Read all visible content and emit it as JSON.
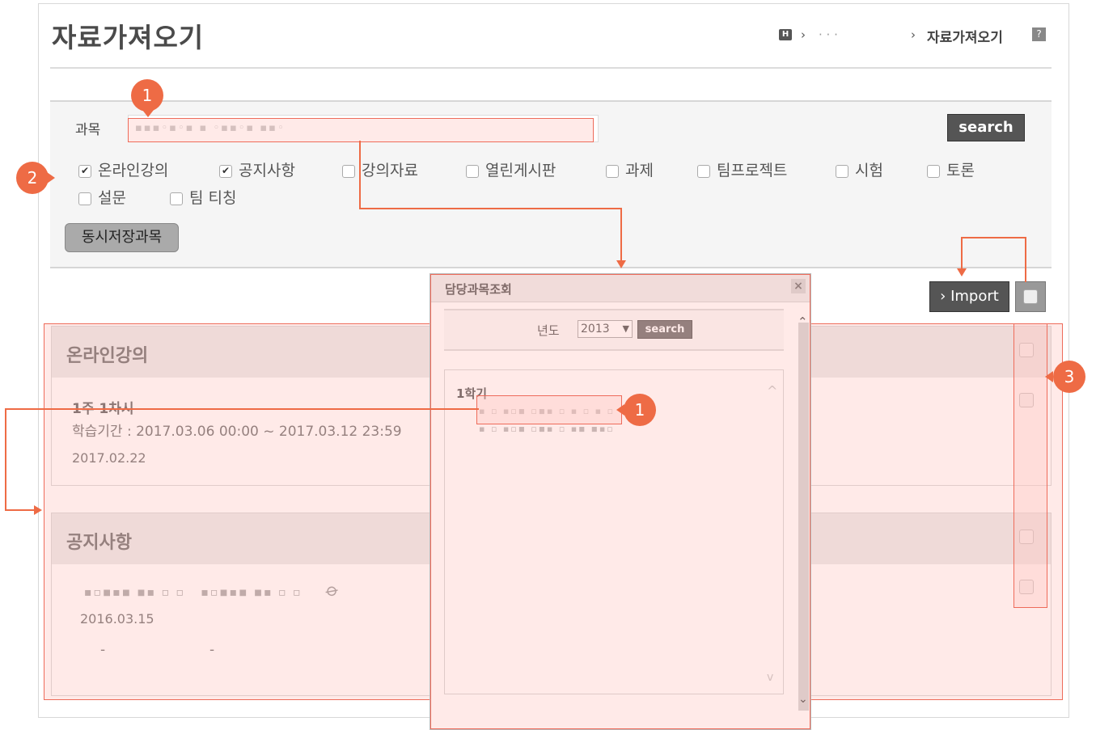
{
  "page": {
    "title": "자료가져오기"
  },
  "breadcrumb": {
    "home": "H",
    "sep1": "›",
    "dots": "·   ·   ·",
    "sep2": "›",
    "current": "자료가져오기",
    "help": "?"
  },
  "search": {
    "label": "과목",
    "value": "",
    "button": "search"
  },
  "categories": [
    {
      "label": "온라인강의",
      "checked": true
    },
    {
      "label": "공지사항",
      "checked": true
    },
    {
      "label": "강의자료",
      "checked": false
    },
    {
      "label": "열린게시판",
      "checked": false
    },
    {
      "label": "과제",
      "checked": false
    },
    {
      "label": "팀프로젝트",
      "checked": false
    },
    {
      "label": "시험",
      "checked": false
    },
    {
      "label": "토론",
      "checked": false
    },
    {
      "label": "설문",
      "checked": false
    },
    {
      "label": "팀 티칭",
      "checked": false
    }
  ],
  "save_button": "동시저장과목",
  "import_button": "› Import",
  "sections": {
    "online": {
      "title": "온라인강의",
      "item_title": "1주 1차시",
      "period": "학습기간 : 2017.03.06 00:00 ~ 2017.03.12 23:59",
      "date": "2017.02.22"
    },
    "notice": {
      "title": "공지사항",
      "date": "2016.03.15",
      "dash1": "-",
      "dash2": "-"
    }
  },
  "modal": {
    "title": "담당과목조회",
    "close": "×",
    "year_label": "년도",
    "year_value": "2013",
    "search_button": "search",
    "semester": "1학기"
  },
  "annotations": {
    "badge1": "1",
    "badge2": "2",
    "badge3": "3",
    "badge1b": "1"
  },
  "colors": {
    "accent": "#ee6b45",
    "overlay": "#ffc8c3"
  }
}
